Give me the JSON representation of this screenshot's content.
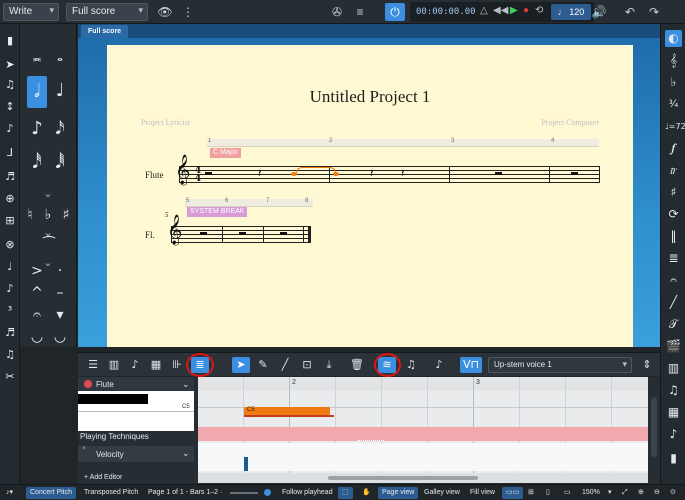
{
  "top": {
    "mode": "Write",
    "layout": "Full score",
    "time": "00:00:00.00",
    "tempo": "120"
  },
  "tabs": [
    "Full score"
  ],
  "score": {
    "title": "Untitled Project 1",
    "lyricist": "Project Lyricist",
    "composer": "Project Composer",
    "key_label": "C Major",
    "break_label": "SYSTEM BREAK",
    "instrument_full": "Flute",
    "instrument_short": "Fl.",
    "bar_numbers": [
      "1",
      "2",
      "3",
      "4"
    ],
    "bar_numbers_2": [
      "5",
      "6",
      "7",
      "8"
    ],
    "system2_number": "5",
    "time_sig_top": "4",
    "time_sig_bottom": "4"
  },
  "lower": {
    "voice": "Up-stem voice 1"
  },
  "key_editor": {
    "instrument": "Flute",
    "pitch_label": "C5",
    "note_label": "C5",
    "bars": [
      "2",
      "3"
    ],
    "playing_techniques": "Playing Techniques",
    "velocity": "Velocity",
    "add_editor": "+ Add Editor"
  },
  "status": {
    "concert_pitch": "Concert Pitch",
    "transposed_pitch": "Transposed Pitch",
    "page_info": "Page 1 of 1 - Bars 1–2 ·",
    "follow_playhead": "Follow playhead",
    "page_view": "Page view",
    "galley_view": "Galley view",
    "fill_view": "Fill view",
    "zoom": "150%"
  },
  "colors": {
    "accent": "#3b8fe0",
    "page": "#fef9d2",
    "key_sig": "#f0a0a0",
    "system_break": "#d89bd6",
    "note_orange": "#f07a12",
    "playing_tech_lane": "#f1a9ae",
    "annotation": "#e01515"
  }
}
